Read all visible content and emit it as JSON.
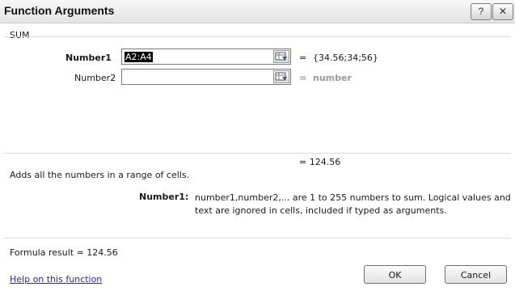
{
  "dialog": {
    "title": "Function Arguments",
    "help_button": "?",
    "close_button": "✕"
  },
  "function": {
    "name": "SUM",
    "args": [
      {
        "label": "Number1",
        "value": "A2:A4",
        "equals": "=",
        "preview": "{34.56;34;56}"
      },
      {
        "label": "Number2",
        "value": "",
        "equals": "=",
        "preview": "number"
      }
    ],
    "result_equals": "= 124.56"
  },
  "description": {
    "function": "Adds all the numbers in a range of cells.",
    "arg_label": "Number1:",
    "arg_text": "number1,number2,... are 1 to 255 numbers to sum. Logical values and text are ignored in cells, included if typed as arguments."
  },
  "footer": {
    "formula_result": "Formula result =  124.56",
    "help_link": "Help on this function",
    "ok": "OK",
    "cancel": "Cancel"
  }
}
